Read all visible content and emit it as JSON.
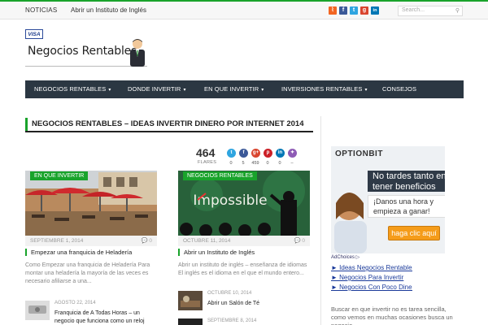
{
  "topbar": {
    "news_label": "NOTICIAS",
    "ticker": "Abrir un Instituto de Inglés",
    "social": [
      {
        "icon": "rss-icon",
        "glyph": "⌇",
        "color": "#f26522"
      },
      {
        "icon": "facebook-icon",
        "glyph": "f",
        "color": "#3b5998"
      },
      {
        "icon": "twitter-icon",
        "glyph": "t",
        "color": "#2fa5e0"
      },
      {
        "icon": "googleplus-icon",
        "glyph": "g",
        "color": "#d9452f"
      },
      {
        "icon": "linkedin-icon",
        "glyph": "in",
        "color": "#0077b5"
      }
    ],
    "search_placeholder": "Search..."
  },
  "logo": {
    "badge": "VISA",
    "title": "Negocios Rentables"
  },
  "nav": [
    {
      "label": "NEGOCIOS RENTABLES",
      "caret": "▾"
    },
    {
      "label": "DONDE INVERTIR",
      "caret": "▾"
    },
    {
      "label": "EN QUE INVERTIR",
      "caret": "▾"
    },
    {
      "label": "INVERSIONES RENTABLES",
      "caret": "▾"
    },
    {
      "label": "CONSEJOS",
      "caret": ""
    }
  ],
  "heading": "NEGOCIOS RENTABLES – IDEAS INVERTIR DINERO POR INTERNET 2014",
  "shares": {
    "total": "464",
    "label": "FLARES",
    "buttons": [
      {
        "icon": "twitter-icon",
        "glyph": "t",
        "color": "#2fa5e0",
        "count": "0"
      },
      {
        "icon": "facebook-icon",
        "glyph": "f",
        "color": "#3b5998",
        "count": "5"
      },
      {
        "icon": "googleplus-icon",
        "glyph": "g+",
        "color": "#d9452f",
        "count": "459"
      },
      {
        "icon": "pinterest-icon",
        "glyph": "p",
        "color": "#cb2027",
        "count": "0"
      },
      {
        "icon": "linkedin-icon",
        "glyph": "in",
        "color": "#0077b5",
        "count": "0"
      },
      {
        "icon": "flare-icon",
        "glyph": "✦",
        "color": "#8e5bb5",
        "count": "–"
      }
    ]
  },
  "cards": [
    {
      "tag": "EN QUE INVERTIR",
      "date": "SEPTIEMBRE 1, 2014",
      "comments": "0",
      "title": "Empezar una franquicia de Heladería",
      "excerpt": "Como Empezar una franquicia de Heladería Para montar una heladería la mayoría de las veces es necesario afiliarse a una..."
    },
    {
      "tag": "NEGOCIOS RENTABLES",
      "date": "OCTUBRE 11, 2014",
      "comments": "0",
      "title": "Abrir un Instituto de Inglés",
      "excerpt": "Abrir un instituto de inglés – enseñanza de idiomas El inglés es el idioma en el que el mundo entero...",
      "image_word": "Impossible"
    }
  ],
  "mini_posts": [
    {
      "date": "AGOSTO 22, 2014",
      "title": "Franquicia de A Todas Horas – un negocio que funciona como un reloj"
    },
    {
      "date": "OCTUBRE 10, 2014",
      "title": "Abrir un Salón de Té"
    },
    {
      "date": "SEPTIEMBRE 8, 2014",
      "title": ""
    }
  ],
  "ad": {
    "brand": "OPTIONBIT",
    "headline": "No tardes tanto en tener beneficios",
    "sub": "¡Danos una hora y empieza a ganar!",
    "cta": "haga clic aquí",
    "adchoices": "AdChoices ▷"
  },
  "ad_links": [
    "► Ideas Negocios Rentables",
    "► Negocios Para Invertir",
    "► Negocios Con Poco Dinero"
  ],
  "side_text": "Buscar en que invertir no es tarea sencilla, como vemos en muchas ocasiones busca un negocio"
}
